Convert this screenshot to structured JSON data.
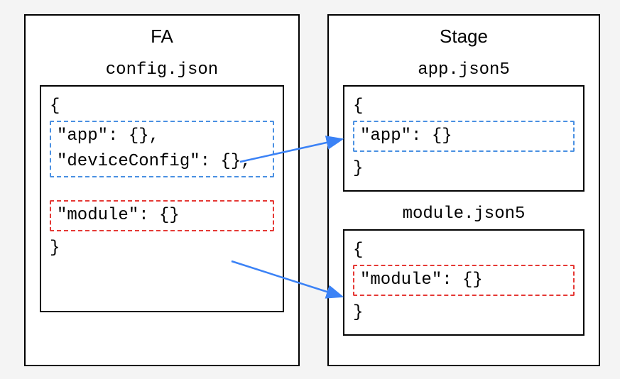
{
  "fa": {
    "title": "FA",
    "file": {
      "name": "config.json",
      "open": "{",
      "close": "}",
      "group1": {
        "line1": "\"app\": {},",
        "line2": "\"deviceConfig\": {},"
      },
      "group2": {
        "line1": "\"module\": {}"
      }
    }
  },
  "stage": {
    "title": "Stage",
    "file1": {
      "name": "app.json5",
      "open": "{",
      "close": "}",
      "group": {
        "line1": "\"app\": {}"
      }
    },
    "file2": {
      "name": "module.json5",
      "open": "{",
      "close": "}",
      "group": {
        "line1": "\"module\": {}"
      }
    }
  },
  "colors": {
    "blue": "#4a90e2",
    "red": "#e53935",
    "arrow": "#3b82f6"
  }
}
